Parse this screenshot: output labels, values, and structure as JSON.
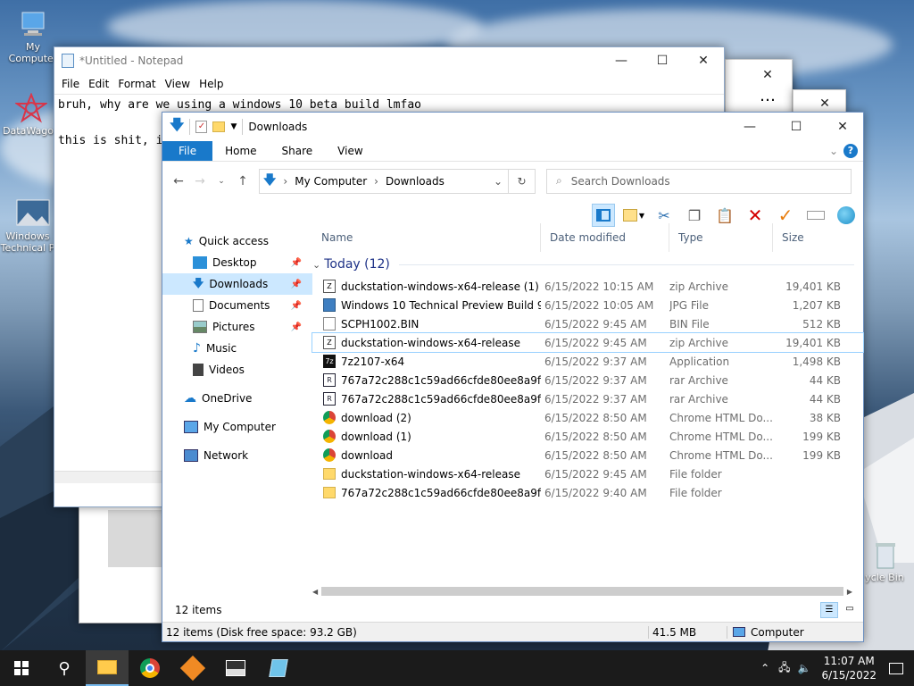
{
  "desktop": {
    "icons": {
      "computer": "My Computer",
      "datawagon": "DataWagon",
      "windows": "Windows Technical P",
      "recycle": "ycle Bin"
    }
  },
  "notepad": {
    "title": "*Untitled - Notepad",
    "menu": [
      "File",
      "Edit",
      "Format",
      "View",
      "Help"
    ],
    "lines": [
      "bruh, why are we using a windows 10 beta build lmfao",
      "",
      "this is shit, i"
    ]
  },
  "explorer": {
    "title": "Downloads",
    "tabs": {
      "file": "File",
      "home": "Home",
      "share": "Share",
      "view": "View"
    },
    "breadcrumb": [
      "My Computer",
      "Downloads"
    ],
    "search_placeholder": "Search Downloads",
    "nav": {
      "quick_access": "Quick access",
      "desktop": "Desktop",
      "downloads": "Downloads",
      "documents": "Documents",
      "pictures": "Pictures",
      "music": "Music",
      "videos": "Videos",
      "onedrive": "OneDrive",
      "mycomputer": "My Computer",
      "network": "Network"
    },
    "columns": {
      "name": "Name",
      "date": "Date modified",
      "type": "Type",
      "size": "Size"
    },
    "group": "Today (12)",
    "files": [
      {
        "name": "duckstation-windows-x64-release (1)",
        "date": "6/15/2022 10:15 AM",
        "type": "zip Archive",
        "size": "19,401 KB",
        "icon": "zip-icon"
      },
      {
        "name": "Windows 10 Technical Preview Build 9926...",
        "date": "6/15/2022 10:05 AM",
        "type": "JPG File",
        "size": "1,207 KB",
        "icon": "image-icon"
      },
      {
        "name": "SCPH1002.BIN",
        "date": "6/15/2022 9:45 AM",
        "type": "BIN File",
        "size": "512 KB",
        "icon": "file-icon"
      },
      {
        "name": "duckstation-windows-x64-release",
        "date": "6/15/2022 9:45 AM",
        "type": "zip Archive",
        "size": "19,401 KB",
        "icon": "zip-icon"
      },
      {
        "name": "7z2107-x64",
        "date": "6/15/2022 9:37 AM",
        "type": "Application",
        "size": "1,498 KB",
        "icon": "7zip-icon"
      },
      {
        "name": "767a72c288c1c59ad66cfde80ee8a9f87c1e...",
        "date": "6/15/2022 9:37 AM",
        "type": "rar Archive",
        "size": "44 KB",
        "icon": "rar-icon"
      },
      {
        "name": "767a72c288c1c59ad66cfde80ee8a9f87c1e...",
        "date": "6/15/2022 9:37 AM",
        "type": "rar Archive",
        "size": "44 KB",
        "icon": "rar-icon"
      },
      {
        "name": "download (2)",
        "date": "6/15/2022 8:50 AM",
        "type": "Chrome HTML Do...",
        "size": "38 KB",
        "icon": "chrome-icon"
      },
      {
        "name": "download (1)",
        "date": "6/15/2022 8:50 AM",
        "type": "Chrome HTML Do...",
        "size": "199 KB",
        "icon": "chrome-icon"
      },
      {
        "name": "download",
        "date": "6/15/2022 8:50 AM",
        "type": "Chrome HTML Do...",
        "size": "199 KB",
        "icon": "chrome-icon"
      },
      {
        "name": "duckstation-windows-x64-release",
        "date": "6/15/2022 9:45 AM",
        "type": "File folder",
        "size": "",
        "icon": "folder-icon"
      },
      {
        "name": "767a72c288c1c59ad66cfde80ee8a9f87c1e...",
        "date": "6/15/2022 9:40 AM",
        "type": "File folder",
        "size": "",
        "icon": "folder-icon"
      }
    ],
    "status_items": "12 items",
    "status_disk": "12 items (Disk free space: 93.2 GB)",
    "status_size": "41.5 MB",
    "status_location": "Computer"
  },
  "taskbar": {
    "time": "11:07 AM",
    "date": "6/15/2022"
  }
}
